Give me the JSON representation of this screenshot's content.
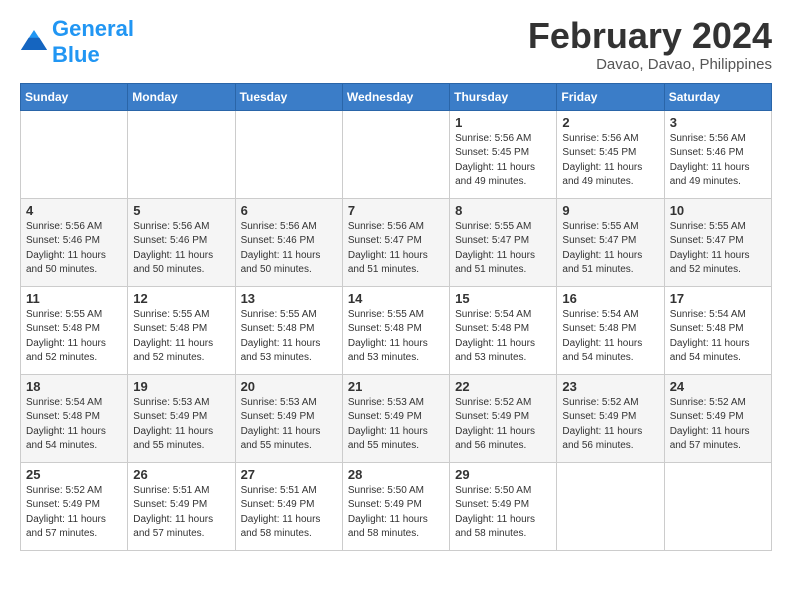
{
  "logo": {
    "text1": "General",
    "text2": "Blue"
  },
  "header": {
    "month": "February 2024",
    "location": "Davao, Davao, Philippines"
  },
  "days_of_week": [
    "Sunday",
    "Monday",
    "Tuesday",
    "Wednesday",
    "Thursday",
    "Friday",
    "Saturday"
  ],
  "weeks": [
    [
      {
        "day": "",
        "detail": ""
      },
      {
        "day": "",
        "detail": ""
      },
      {
        "day": "",
        "detail": ""
      },
      {
        "day": "",
        "detail": ""
      },
      {
        "day": "1",
        "detail": "Sunrise: 5:56 AM\nSunset: 5:45 PM\nDaylight: 11 hours\nand 49 minutes."
      },
      {
        "day": "2",
        "detail": "Sunrise: 5:56 AM\nSunset: 5:45 PM\nDaylight: 11 hours\nand 49 minutes."
      },
      {
        "day": "3",
        "detail": "Sunrise: 5:56 AM\nSunset: 5:46 PM\nDaylight: 11 hours\nand 49 minutes."
      }
    ],
    [
      {
        "day": "4",
        "detail": "Sunrise: 5:56 AM\nSunset: 5:46 PM\nDaylight: 11 hours\nand 50 minutes."
      },
      {
        "day": "5",
        "detail": "Sunrise: 5:56 AM\nSunset: 5:46 PM\nDaylight: 11 hours\nand 50 minutes."
      },
      {
        "day": "6",
        "detail": "Sunrise: 5:56 AM\nSunset: 5:46 PM\nDaylight: 11 hours\nand 50 minutes."
      },
      {
        "day": "7",
        "detail": "Sunrise: 5:56 AM\nSunset: 5:47 PM\nDaylight: 11 hours\nand 51 minutes."
      },
      {
        "day": "8",
        "detail": "Sunrise: 5:55 AM\nSunset: 5:47 PM\nDaylight: 11 hours\nand 51 minutes."
      },
      {
        "day": "9",
        "detail": "Sunrise: 5:55 AM\nSunset: 5:47 PM\nDaylight: 11 hours\nand 51 minutes."
      },
      {
        "day": "10",
        "detail": "Sunrise: 5:55 AM\nSunset: 5:47 PM\nDaylight: 11 hours\nand 52 minutes."
      }
    ],
    [
      {
        "day": "11",
        "detail": "Sunrise: 5:55 AM\nSunset: 5:48 PM\nDaylight: 11 hours\nand 52 minutes."
      },
      {
        "day": "12",
        "detail": "Sunrise: 5:55 AM\nSunset: 5:48 PM\nDaylight: 11 hours\nand 52 minutes."
      },
      {
        "day": "13",
        "detail": "Sunrise: 5:55 AM\nSunset: 5:48 PM\nDaylight: 11 hours\nand 53 minutes."
      },
      {
        "day": "14",
        "detail": "Sunrise: 5:55 AM\nSunset: 5:48 PM\nDaylight: 11 hours\nand 53 minutes."
      },
      {
        "day": "15",
        "detail": "Sunrise: 5:54 AM\nSunset: 5:48 PM\nDaylight: 11 hours\nand 53 minutes."
      },
      {
        "day": "16",
        "detail": "Sunrise: 5:54 AM\nSunset: 5:48 PM\nDaylight: 11 hours\nand 54 minutes."
      },
      {
        "day": "17",
        "detail": "Sunrise: 5:54 AM\nSunset: 5:48 PM\nDaylight: 11 hours\nand 54 minutes."
      }
    ],
    [
      {
        "day": "18",
        "detail": "Sunrise: 5:54 AM\nSunset: 5:48 PM\nDaylight: 11 hours\nand 54 minutes."
      },
      {
        "day": "19",
        "detail": "Sunrise: 5:53 AM\nSunset: 5:49 PM\nDaylight: 11 hours\nand 55 minutes."
      },
      {
        "day": "20",
        "detail": "Sunrise: 5:53 AM\nSunset: 5:49 PM\nDaylight: 11 hours\nand 55 minutes."
      },
      {
        "day": "21",
        "detail": "Sunrise: 5:53 AM\nSunset: 5:49 PM\nDaylight: 11 hours\nand 55 minutes."
      },
      {
        "day": "22",
        "detail": "Sunrise: 5:52 AM\nSunset: 5:49 PM\nDaylight: 11 hours\nand 56 minutes."
      },
      {
        "day": "23",
        "detail": "Sunrise: 5:52 AM\nSunset: 5:49 PM\nDaylight: 11 hours\nand 56 minutes."
      },
      {
        "day": "24",
        "detail": "Sunrise: 5:52 AM\nSunset: 5:49 PM\nDaylight: 11 hours\nand 57 minutes."
      }
    ],
    [
      {
        "day": "25",
        "detail": "Sunrise: 5:52 AM\nSunset: 5:49 PM\nDaylight: 11 hours\nand 57 minutes."
      },
      {
        "day": "26",
        "detail": "Sunrise: 5:51 AM\nSunset: 5:49 PM\nDaylight: 11 hours\nand 57 minutes."
      },
      {
        "day": "27",
        "detail": "Sunrise: 5:51 AM\nSunset: 5:49 PM\nDaylight: 11 hours\nand 58 minutes."
      },
      {
        "day": "28",
        "detail": "Sunrise: 5:50 AM\nSunset: 5:49 PM\nDaylight: 11 hours\nand 58 minutes."
      },
      {
        "day": "29",
        "detail": "Sunrise: 5:50 AM\nSunset: 5:49 PM\nDaylight: 11 hours\nand 58 minutes."
      },
      {
        "day": "",
        "detail": ""
      },
      {
        "day": "",
        "detail": ""
      }
    ]
  ]
}
